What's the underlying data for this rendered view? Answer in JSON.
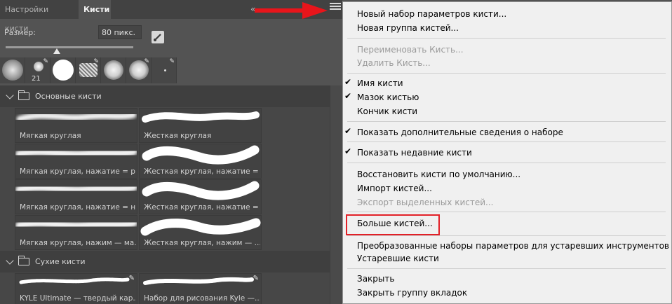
{
  "panel": {
    "tabs": [
      {
        "label": "Настройки кисти"
      },
      {
        "label": "Кисти"
      }
    ],
    "close_glyph": "«",
    "size": {
      "label": "Размер:",
      "value": "80 пикс.",
      "slider_fraction": 0.4
    },
    "recent": [
      {
        "label": ""
      },
      {
        "label": "21"
      },
      {
        "label": ""
      },
      {
        "label": ""
      },
      {
        "label": ""
      },
      {
        "label": ""
      },
      {
        "label": ""
      }
    ],
    "groups": [
      {
        "title": "Основные кисти",
        "brushes": [
          {
            "name": "Мягкая круглая"
          },
          {
            "name": "Жесткая круглая"
          },
          {
            "name": "Мягкая круглая, нажатие = р..."
          },
          {
            "name": "Жесткая круглая, нажатие = ..."
          },
          {
            "name": "Мягкая круглая, нажатие = н..."
          },
          {
            "name": "Жесткая круглая, нажатие = ..."
          },
          {
            "name": "Мягкая круглая, нажим — ма..."
          },
          {
            "name": "Жесткая круглая, нажим — ..."
          }
        ]
      },
      {
        "title": "Сухие кисти",
        "brushes": [
          {
            "name": "KYLE Ultimate — твердый кар..."
          },
          {
            "name": "Набор для рисования Kyle —..."
          }
        ]
      }
    ]
  },
  "menu": {
    "new_brush_preset": "Новый набор параметров кисти...",
    "new_brush_group": "Новая группа кистей...",
    "rename_brush": "Переименовать Кисть...",
    "delete_brush": "Удалить Кисть...",
    "brush_name": "Имя кисти",
    "brush_stroke": "Мазок кистью",
    "brush_tip": "Кончик кисти",
    "show_additional_info": "Показать дополнительные сведения о наборе",
    "show_recent_brushes": "Показать недавние кисти",
    "restore_default": "Восстановить кисти по умолчанию...",
    "import_brushes": "Импорт кистей...",
    "export_selected": "Экспорт выделенных кистей...",
    "more_brushes": "Больше кистей...",
    "converted_legacy": "Преобразованные наборы параметров для устаревших инструментов",
    "legacy_brushes": "Устаревшие кисти",
    "close": "Закрыть",
    "close_tab_group": "Закрыть группу вкладок",
    "checkmark": "✔"
  },
  "colors": {
    "highlight": "#e22027",
    "arrow": "#e8151b"
  }
}
